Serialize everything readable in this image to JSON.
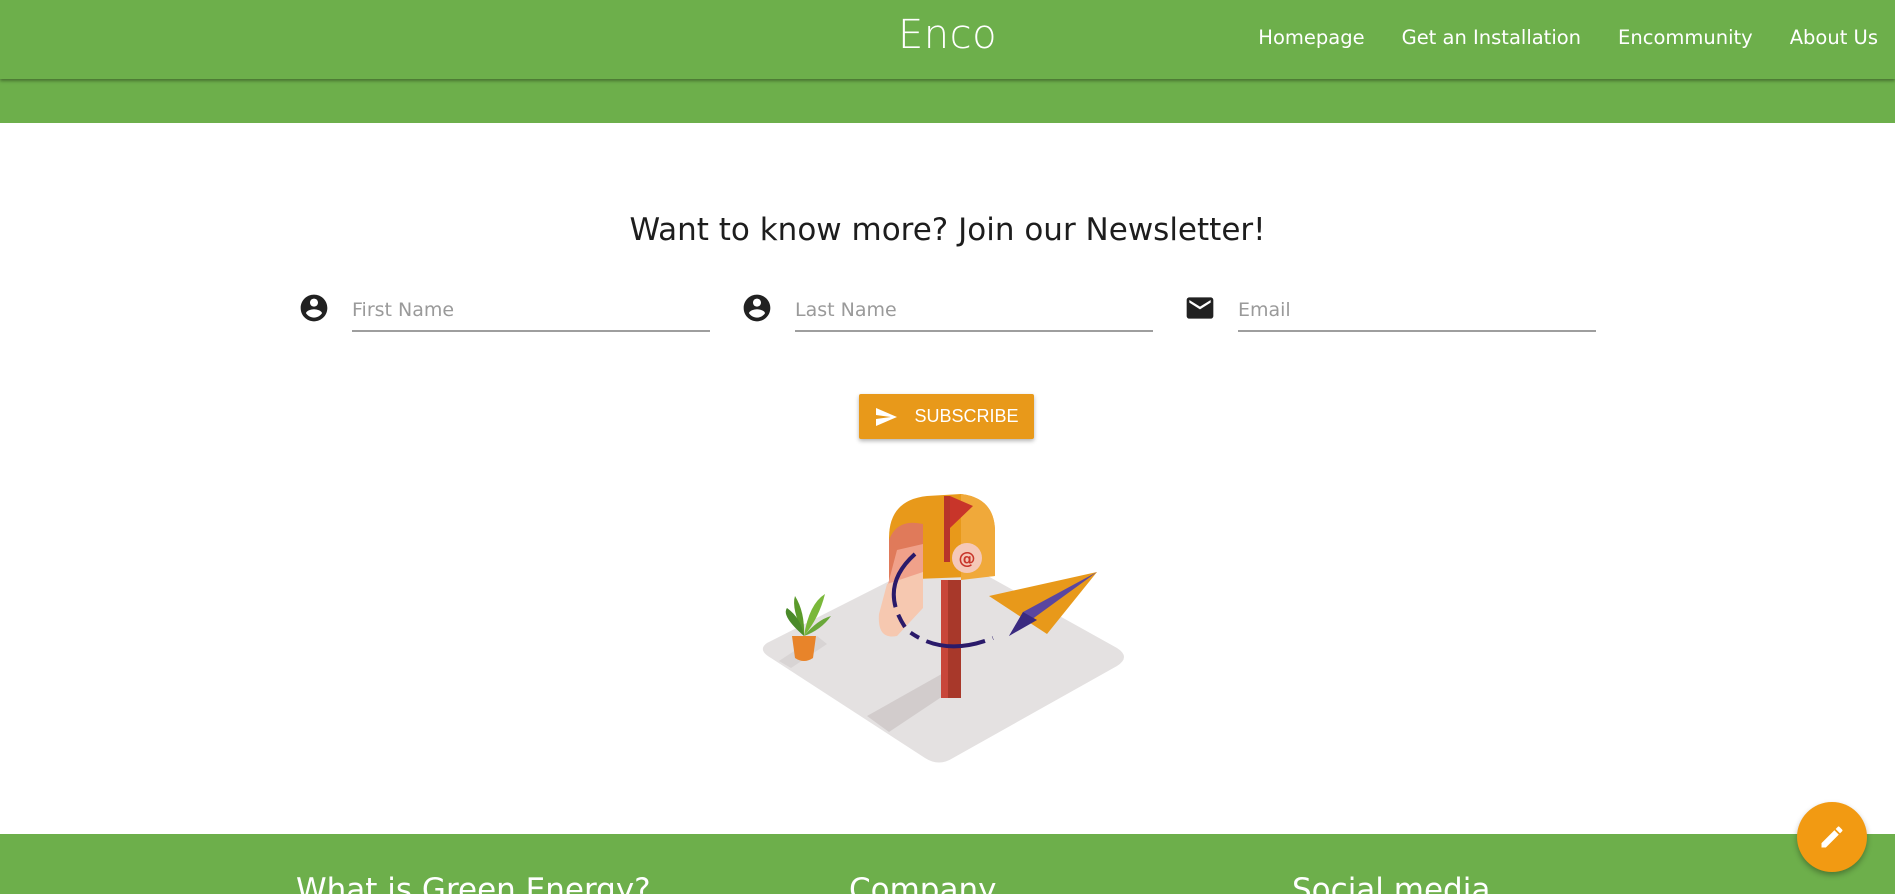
{
  "header": {
    "brand": "Enco",
    "nav": [
      "Homepage",
      "Get an Installation",
      "Encommunity",
      "About Us"
    ]
  },
  "newsletter": {
    "title": "Want to know more? Join our Newsletter!",
    "first_name_placeholder": "First Name",
    "last_name_placeholder": "Last Name",
    "email_placeholder": "Email",
    "subscribe_label": "SUBSCRIBE",
    "illustration_mark": "@"
  },
  "footer": {
    "headings": [
      "What is Green Energy?",
      "Company",
      "Social media"
    ]
  },
  "icons": {
    "first_name": "account-circle-icon",
    "last_name": "account-circle-icon",
    "email": "mail-icon",
    "subscribe": "send-icon",
    "fab": "pencil-icon"
  },
  "colors": {
    "brand_green": "#6daf4b",
    "accent_orange": "#e8991a",
    "fab_orange": "#f29a12"
  }
}
